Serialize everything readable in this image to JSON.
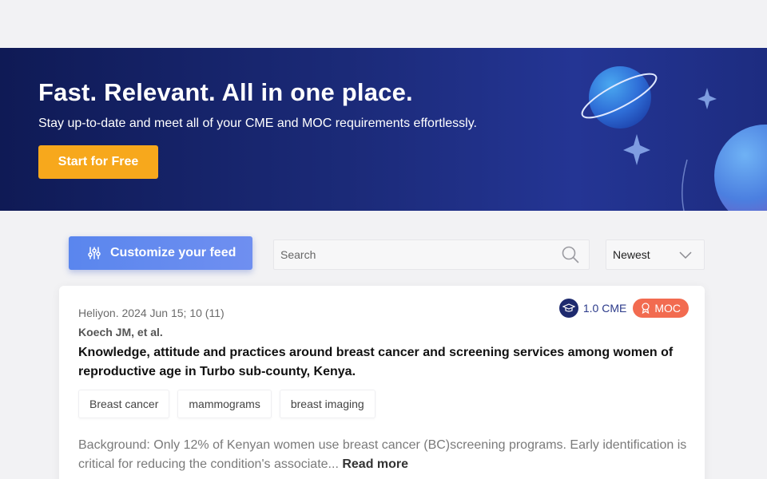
{
  "hero": {
    "title": "Fast. Relevant. All in one place.",
    "subtitle": "Stay up-to-date and meet all of your CME and MOC requirements effortlessly.",
    "cta_label": "Start for Free"
  },
  "toolbar": {
    "customize_label": "Customize your feed",
    "customize_icon": "sliders-icon",
    "search_placeholder": "Search",
    "search_value": "",
    "search_icon": "search-icon",
    "sort_selected": "Newest",
    "sort_icon": "chevron-down-icon"
  },
  "article": {
    "source": "Heliyon. 2024 Jun 15; 10 (11)",
    "authors": "Koech JM, et al.",
    "title": "Knowledge, attitude and practices around breast cancer and screening services among women of reproductive age in Turbo sub-county, Kenya.",
    "cme_label": "1.0 CME",
    "cme_icon": "graduation-cap-icon",
    "moc_label": "MOC",
    "moc_icon": "award-icon",
    "tags": [
      "Breast cancer",
      "mammograms",
      "breast imaging"
    ],
    "abstract": "Background: Only 12% of Kenyan women use breast cancer (BC)screening programs. Early identification is critical for reducing the condition's associate...",
    "read_more_label": "Read more"
  },
  "colors": {
    "hero_bg": "#1b2a78",
    "cta": "#f7a81c",
    "customize": "#6a8cef",
    "moc": "#f26b50",
    "cme": "#1e2a6e"
  }
}
